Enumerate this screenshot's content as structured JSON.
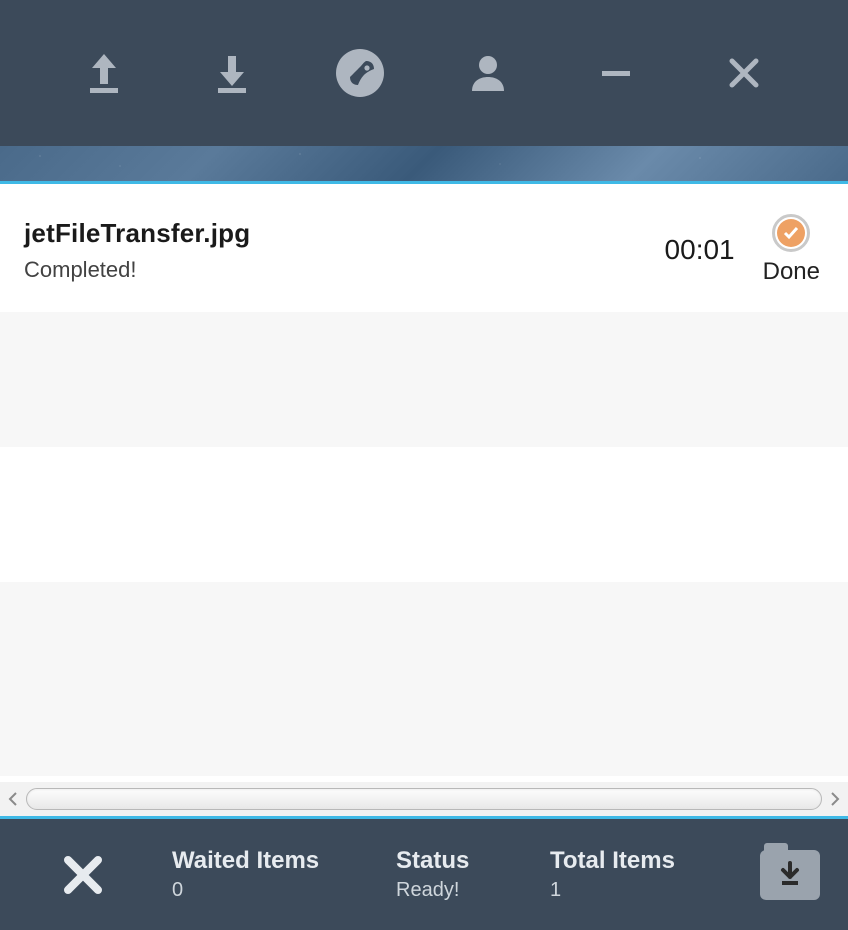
{
  "toolbar": {
    "upload": "upload",
    "download": "download",
    "rocket": "rocket",
    "user": "user",
    "minimize": "minimize",
    "close": "close"
  },
  "transfers": [
    {
      "filename": "jetFileTransfer.jpg",
      "status": "Completed!",
      "elapsed": "00:01",
      "state_label": "Done"
    }
  ],
  "footer": {
    "clear": "clear",
    "waited_label": "Waited Items",
    "waited_value": "0",
    "status_label": "Status",
    "status_value": "Ready!",
    "total_label": "Total Items",
    "total_value": "1",
    "download_folder": "open-downloads"
  }
}
